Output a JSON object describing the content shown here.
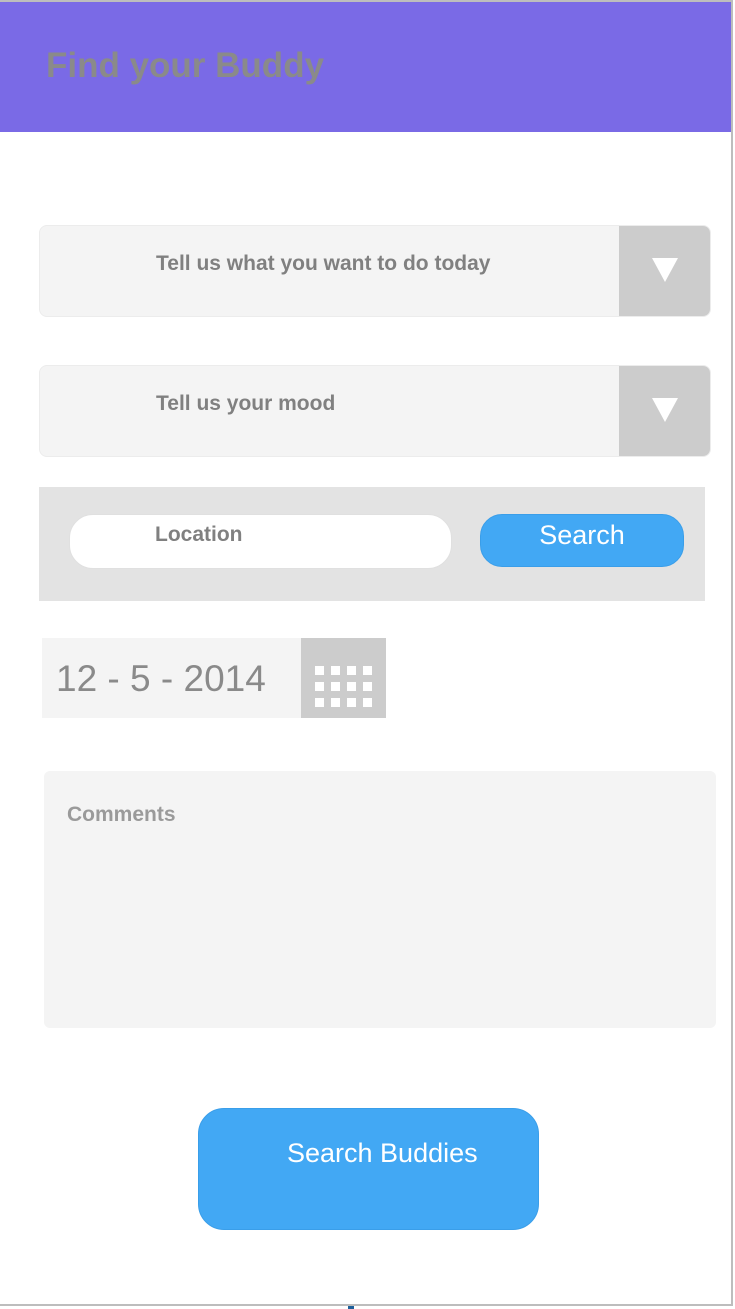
{
  "header": {
    "title": "Find your Buddy"
  },
  "activity_dropdown": {
    "placeholder": "Tell us what you want to do today",
    "arrow": "caret-down-icon"
  },
  "mood_dropdown": {
    "placeholder": "Tell us your mood",
    "arrow": "caret-down-icon"
  },
  "location": {
    "placeholder": "Location",
    "search_label": "Search"
  },
  "date": {
    "value": "12 - 5 - 2014",
    "picker_icon": "calendar-icon"
  },
  "comments": {
    "placeholder": "Comments"
  },
  "submit": {
    "label": "Search Buddies"
  },
  "colors": {
    "header_bg": "#7a6ae6",
    "button_blue": "#42a8f4",
    "field_bg": "#f4f4f4",
    "arrow_box": "#cccccc"
  }
}
